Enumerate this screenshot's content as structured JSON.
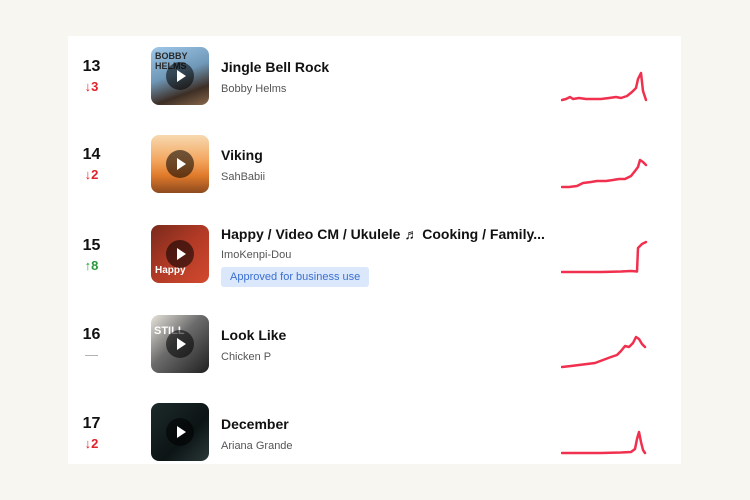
{
  "chart_items": [
    {
      "rank": "13",
      "change": "3",
      "direction": "down",
      "title": "Jingle Bell Rock",
      "artist": "Bobby Helms",
      "badge": "",
      "thumb_text": "BOBBY HELMS"
    },
    {
      "rank": "14",
      "change": "2",
      "direction": "down",
      "title": "Viking",
      "artist": "SahBabii",
      "badge": "",
      "thumb_text": ""
    },
    {
      "rank": "15",
      "change": "8",
      "direction": "up",
      "title": "Happy / Video CM / Ukulele ♬ Cooking / Family...",
      "artist": "ImoKenpi-Dou",
      "badge": "Approved for business use",
      "thumb_text": "Happy"
    },
    {
      "rank": "16",
      "change": "—",
      "direction": "same",
      "title": "Look Like",
      "artist": "Chicken P",
      "badge": "",
      "thumb_text": "STILL"
    },
    {
      "rank": "17",
      "change": "2",
      "direction": "down",
      "title": "December",
      "artist": "Ariana Grande",
      "badge": "",
      "thumb_text": ""
    }
  ],
  "icons": {
    "up": "↑",
    "down": "↓"
  },
  "colors": {
    "trend_line": "#f0304e",
    "down": "#e0222b",
    "up": "#2a9a3a",
    "badge_bg": "#dbe8fb"
  }
}
